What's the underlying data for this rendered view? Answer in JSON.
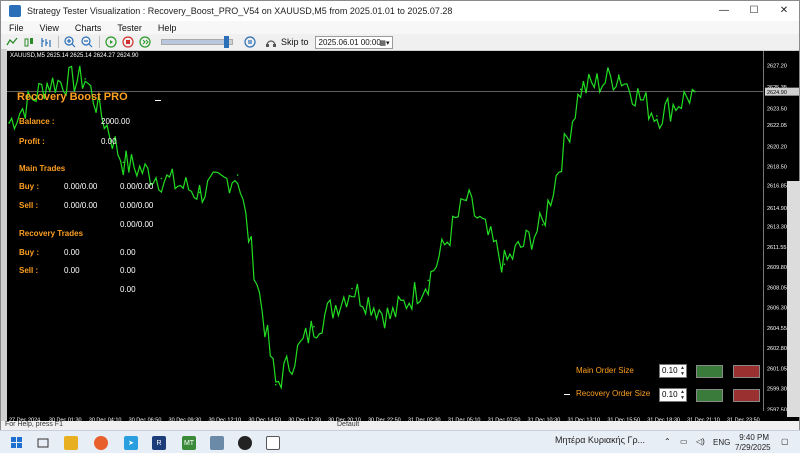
{
  "window": {
    "title": "Strategy Tester Visualization : Recovery_Boost_PRO_V54 on XAUUSD,M5 from 2025.01.01 to 2025.07.28",
    "minimize": "—",
    "maximize": "☐",
    "close": "✕"
  },
  "menu": [
    "File",
    "View",
    "Charts",
    "Tester",
    "Help"
  ],
  "toolbar": {
    "skip_label": "Skip to",
    "skip_date": "2025.06.01 00:00",
    "speed_percent": 91
  },
  "chart": {
    "header": "XAUUSD,M5  2625.14 2625.14 2624.27 2624.90",
    "current_price": "2624.90",
    "price_ticks": [
      "2627.20",
      "2625.35",
      "2624.90",
      "2623.50",
      "2622.05",
      "2620.20",
      "2618.50",
      "2616.85",
      "2614.90",
      "2613.30",
      "2611.55",
      "2609.80",
      "2608.05",
      "2606.30",
      "2604.55",
      "2602.80",
      "2601.05",
      "2599.30",
      "2597.50"
    ],
    "time_ticks": [
      "27 Dec 2024",
      "30 Dec 01:30",
      "30 Dec 04:10",
      "30 Dec 06:50",
      "30 Dec 09:30",
      "30 Dec 12:10",
      "30 Dec 14:50",
      "30 Dec 17:30",
      "30 Dec 20:10",
      "30 Dec 22:50",
      "31 Dec 02:30",
      "31 Dec 05:10",
      "31 Dec 07:50",
      "31 Dec 10:30",
      "31 Dec 13:10",
      "31 Dec 15:50",
      "31 Dec 18:30",
      "31 Dec 21:10",
      "31 Dec 23:50"
    ],
    "line_color": "#22dd22",
    "background": "#000000"
  },
  "chart_data": {
    "type": "line",
    "title": "",
    "xlabel": "",
    "ylabel": "",
    "ylim": [
      2597.5,
      2627.2
    ],
    "x": [
      "27 Dec 2024",
      "30 Dec 01:30",
      "30 Dec 04:10",
      "30 Dec 06:50",
      "30 Dec 09:30",
      "30 Dec 12:10",
      "30 Dec 14:50",
      "30 Dec 17:30",
      "30 Dec 20:10",
      "30 Dec 22:50",
      "31 Dec 02:30",
      "31 Dec 05:10",
      "31 Dec 07:50",
      "31 Dec 10:30",
      "31 Dec 13:10",
      "31 Dec 15:50",
      "31 Dec 18:30",
      "31 Dec 21:10",
      "31 Dec 23:50"
    ],
    "series": [
      {
        "values": [
          2622.2,
          2625.6,
          2626.0,
          2618.8,
          2617.4,
          2616.2,
          2617.7,
          2599.6,
          2604.6,
          2607.9,
          2605.4,
          2608.6,
          2615.6,
          2610.0,
          2613.4,
          2625.1,
          2626.3,
          2622.8,
          2624.9
        ]
      }
    ]
  },
  "panel": {
    "title": "Recovery Boost PRO",
    "balance_label": "Balance :",
    "balance_value": "2000.00",
    "profit_label": "Profit :",
    "profit_value": "0.00",
    "main_trades_label": "Main Trades",
    "main_buy_label": "Buy :",
    "main_buy_lots": "0.00/0.00",
    "main_buy_pl": "0.00/0.00",
    "main_sell_label": "Sell :",
    "main_sell_lots": "0.00/0.00",
    "main_sell_pl": "0.00/0.00",
    "main_total": "0.00/0.00",
    "recovery_trades_label": "Recovery Trades",
    "rec_buy_label": "Buy :",
    "rec_buy_lots": "0.00",
    "rec_buy_pl": "0.00",
    "rec_sell_label": "Sell :",
    "rec_sell_lots": "0.00",
    "rec_sell_pl": "0.00",
    "rec_total": "0.00",
    "main_order_label": "Main Order Size",
    "main_order_value": "0.10",
    "recovery_order_label": "Recovery Order Size",
    "recovery_order_value": "0.10"
  },
  "status": {
    "help": "For Help, press F1",
    "default": "Default"
  },
  "taskbar": {
    "news": "Μητέρα Κυριακής Γρ...",
    "lang": "ENG",
    "time": "9:40 PM",
    "date": "7/29/2025"
  }
}
